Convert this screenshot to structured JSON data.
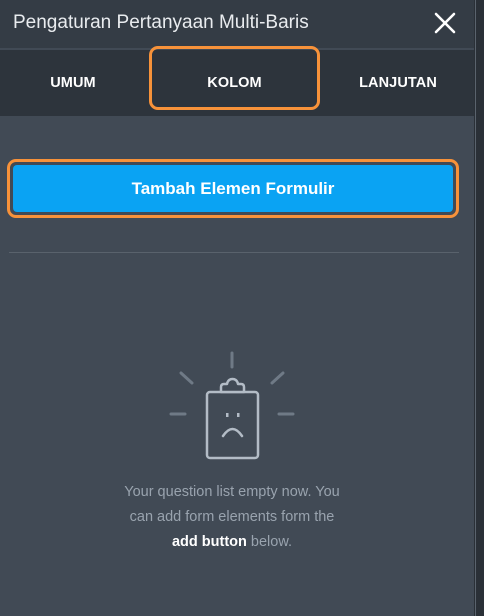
{
  "dialog": {
    "title": "Pengaturan Pertanyaan Multi-Baris",
    "close_icon": "close-icon"
  },
  "tabs": [
    {
      "label": "UMUM",
      "active": false
    },
    {
      "label": "KOLOM",
      "active": true
    },
    {
      "label": "LANJUTAN",
      "active": false
    }
  ],
  "add_button": {
    "label": "Tambah Elemen Formulir",
    "color": "#0aa3f3"
  },
  "empty_state": {
    "icon": "empty-clipboard-icon",
    "message_line_1": "Your question list empty now. You",
    "message_line_2": "can add form elements form the",
    "message_highlight": "add button",
    "message_tail": " below."
  },
  "colors": {
    "panel_bg": "#414a55",
    "header_bg": "#343c45",
    "tabs_bg": "#2d343c",
    "highlight": "#f7923a"
  }
}
